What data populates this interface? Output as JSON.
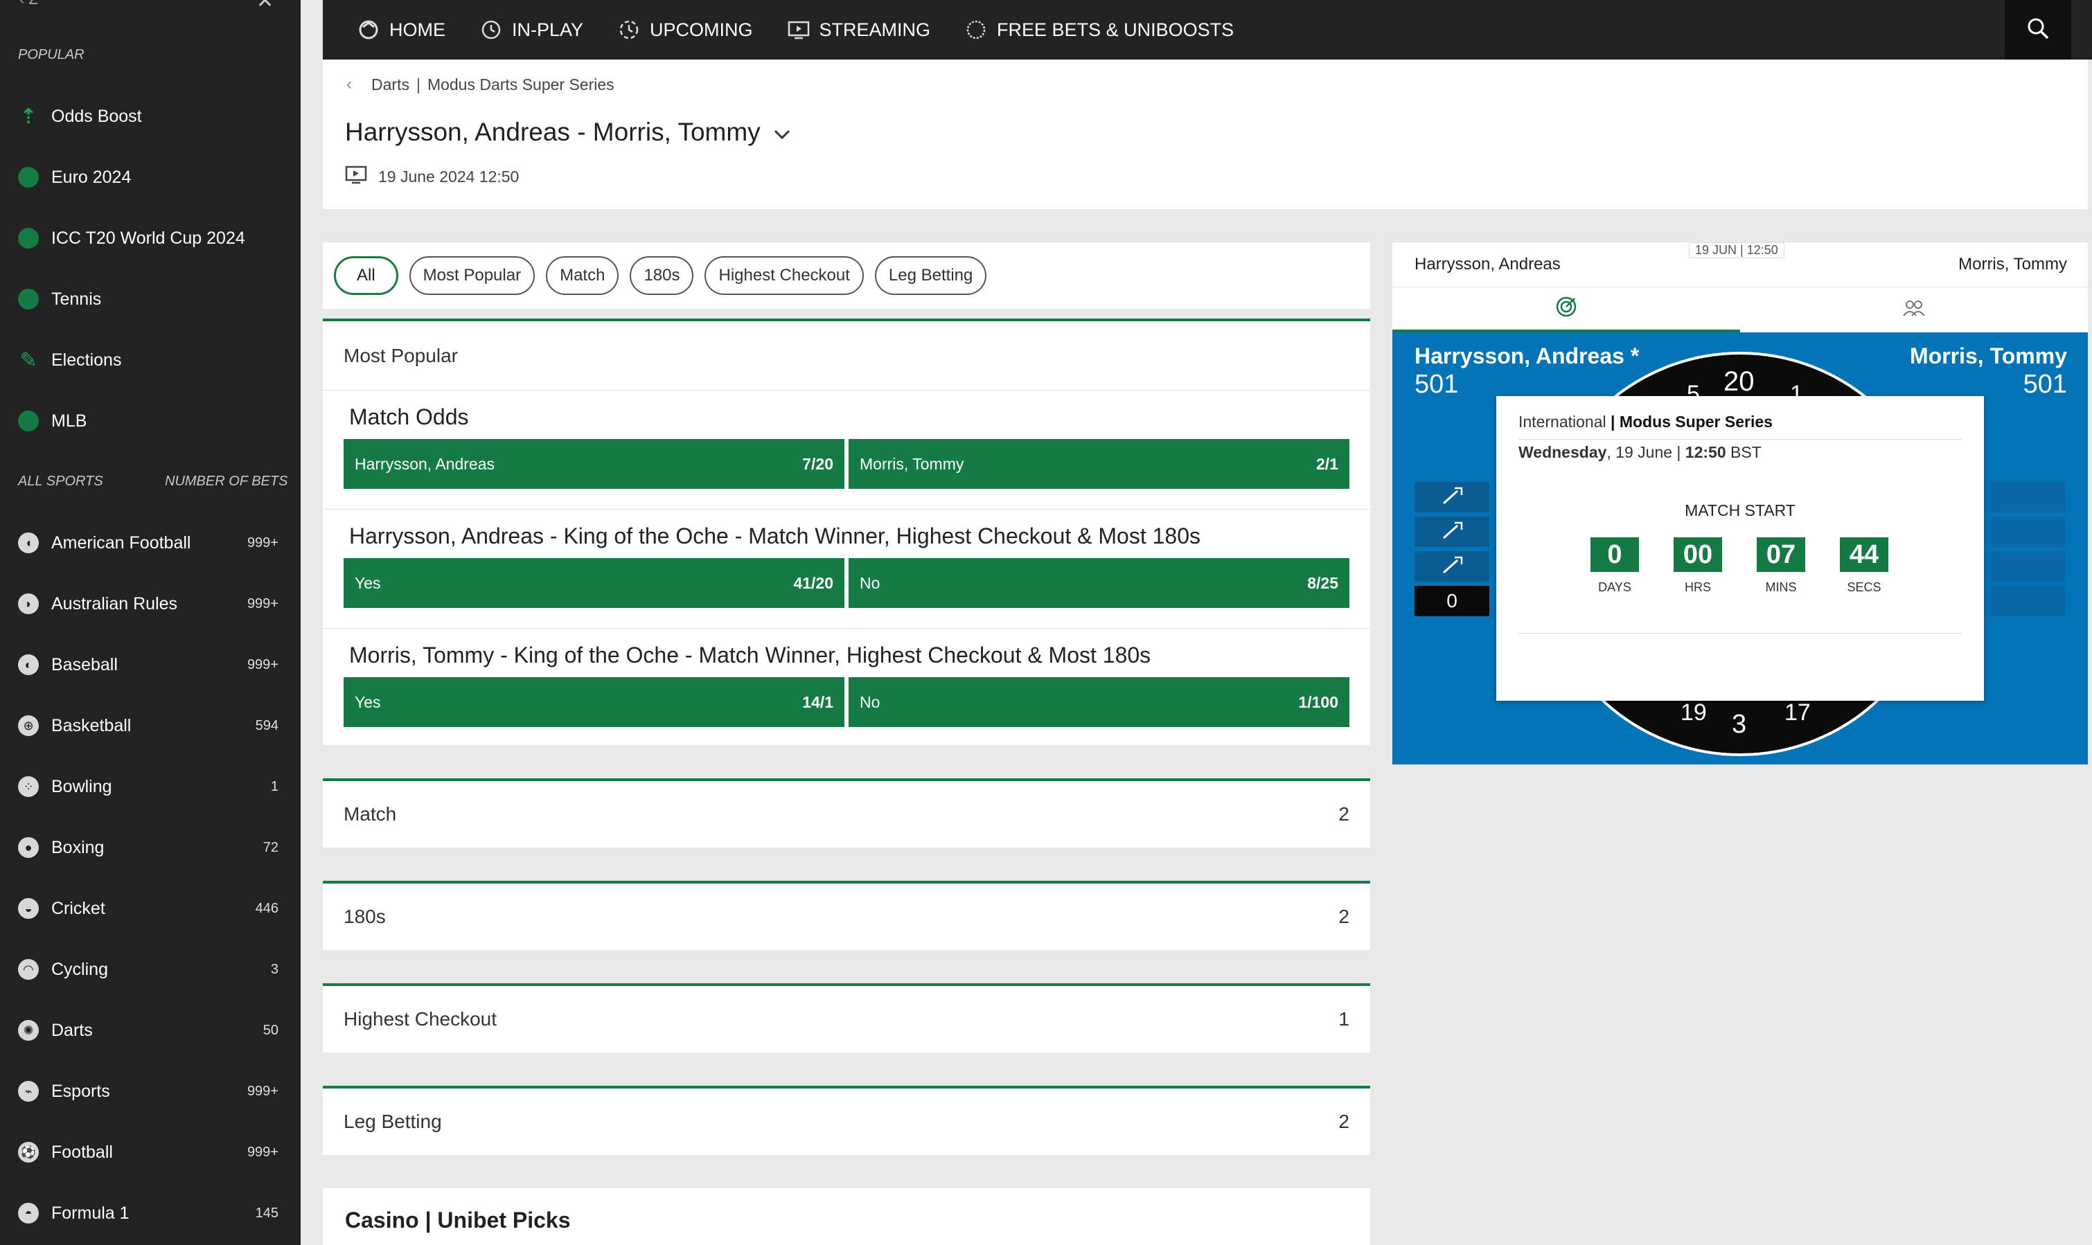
{
  "sidebar": {
    "popular_heading": "POPULAR",
    "popular": [
      {
        "label": "Odds Boost",
        "icon": "odds-boost-arrow-icon"
      },
      {
        "label": "Euro 2024",
        "icon": "football-icon"
      },
      {
        "label": "ICC T20 World Cup 2024",
        "icon": "cricket-icon"
      },
      {
        "label": "Tennis",
        "icon": "tennis-icon"
      },
      {
        "label": "Elections",
        "icon": "elections-icon"
      },
      {
        "label": "MLB",
        "icon": "baseball-icon"
      }
    ],
    "all_sports_heading": "ALL SPORTS",
    "number_of_bets_heading": "NUMBER OF BETS",
    "sports": [
      {
        "label": "American Football",
        "count": "999+"
      },
      {
        "label": "Australian Rules",
        "count": "999+"
      },
      {
        "label": "Baseball",
        "count": "999+"
      },
      {
        "label": "Basketball",
        "count": "594"
      },
      {
        "label": "Bowling",
        "count": "1"
      },
      {
        "label": "Boxing",
        "count": "72"
      },
      {
        "label": "Cricket",
        "count": "446"
      },
      {
        "label": "Cycling",
        "count": "3"
      },
      {
        "label": "Darts",
        "count": "50"
      },
      {
        "label": "Esports",
        "count": "999+"
      },
      {
        "label": "Football",
        "count": "999+"
      },
      {
        "label": "Formula 1",
        "count": "145"
      }
    ]
  },
  "topnav": {
    "items": [
      {
        "label": "HOME",
        "icon": "home-icon"
      },
      {
        "label": "IN-PLAY",
        "icon": "clock-icon"
      },
      {
        "label": "UPCOMING",
        "icon": "upcoming-icon"
      },
      {
        "label": "STREAMING",
        "icon": "streaming-icon"
      },
      {
        "label": "FREE BETS & UNIBOOSTS",
        "icon": "unibet-icon"
      }
    ]
  },
  "header": {
    "breadcrumb": [
      "Darts",
      "Modus Darts Super Series"
    ],
    "breadcrumb_sep": "|",
    "title": "Harrysson, Andreas - Morris, Tommy",
    "date": "19 June 2024 12:50"
  },
  "filters": [
    "All",
    "Most Popular",
    "Match",
    "180s",
    "Highest Checkout",
    "Leg Betting"
  ],
  "most_popular": {
    "heading": "Most Popular",
    "markets": [
      {
        "title": "Match Odds",
        "outcomes": [
          {
            "label": "Harrysson, Andreas",
            "price": "7/20"
          },
          {
            "label": "Morris, Tommy",
            "price": "2/1"
          }
        ]
      },
      {
        "title": "Harrysson, Andreas - King of the Oche - Match Winner, Highest Checkout & Most 180s",
        "outcomes": [
          {
            "label": "Yes",
            "price": "41/20"
          },
          {
            "label": "No",
            "price": "8/25"
          }
        ]
      },
      {
        "title": "Morris, Tommy - King of the Oche - Match Winner, Highest Checkout & Most 180s",
        "outcomes": [
          {
            "label": "Yes",
            "price": "14/1"
          },
          {
            "label": "No",
            "price": "1/100"
          }
        ]
      }
    ]
  },
  "collapsed_markets": [
    {
      "label": "Match",
      "count": "2"
    },
    {
      "label": "180s",
      "count": "2"
    },
    {
      "label": "Highest Checkout",
      "count": "1"
    },
    {
      "label": "Leg Betting",
      "count": "2"
    }
  ],
  "casino_heading": "Casino | Unibet Picks",
  "scoreboard": {
    "player_left": "Harrysson, Andreas",
    "player_right": "Morris, Tommy",
    "date_badge": "19 JUN | 12:50",
    "board_left_name": "Harrysson, Andreas *",
    "board_left_score": "501",
    "board_right_name": "Morris, Tommy",
    "board_right_score": "501",
    "left_legs": "0",
    "board_numbers": [
      "5",
      "20",
      "1",
      "19",
      "3",
      "17"
    ]
  },
  "countdown": {
    "league_prefix": "International",
    "league_sep": " | ",
    "league_name": "Modus Super Series",
    "day": "Wednesday",
    "date_rest": ", 19 June | ",
    "time": "12:50",
    "tz": " BST",
    "heading": "MATCH START",
    "units": [
      {
        "value": "0",
        "label": "DAYS"
      },
      {
        "value": "00",
        "label": "HRS"
      },
      {
        "value": "07",
        "label": "MINS"
      },
      {
        "value": "44",
        "label": "SECS"
      }
    ]
  },
  "colors": {
    "brand_green": "#147b45",
    "sidebar_bg": "#222222",
    "board_blue": "#0474b8"
  }
}
